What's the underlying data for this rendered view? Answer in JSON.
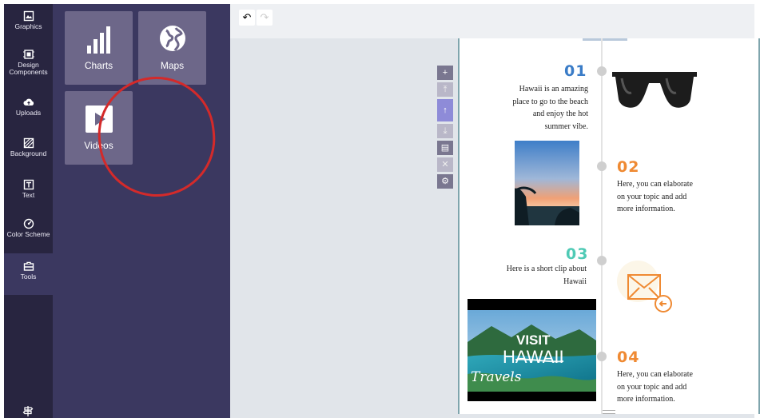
{
  "rail": {
    "items": [
      {
        "label": "Graphics",
        "icon": "image-icon"
      },
      {
        "label": "Design Components",
        "icon": "components-icon"
      },
      {
        "label": "Uploads",
        "icon": "cloud-upload-icon"
      },
      {
        "label": "Background",
        "icon": "pattern-icon"
      },
      {
        "label": "Text",
        "icon": "text-icon"
      },
      {
        "label": "Color Scheme",
        "icon": "palette-icon"
      },
      {
        "label": "Tools",
        "icon": "toolbox-icon"
      }
    ],
    "active": "Tools"
  },
  "panel": {
    "tiles": [
      {
        "label": "Charts",
        "icon": "bar-chart-icon"
      },
      {
        "label": "Maps",
        "icon": "globe-icon"
      },
      {
        "label": "Videos",
        "icon": "play-icon"
      }
    ]
  },
  "toolbar": {
    "undo": "↶",
    "redo": "↷"
  },
  "canvas_tools": [
    "+",
    "⤒",
    "↑",
    "⤓",
    "▤",
    "✕",
    "⚙"
  ],
  "infographic": {
    "steps": [
      {
        "number": "01",
        "color": "#3a7cc7",
        "text": [
          "Hawaii is an amazing",
          "place to go to the beach",
          "and enjoy the hot",
          "summer vibe."
        ]
      },
      {
        "number": "02",
        "color": "#ef8a33",
        "text": [
          "Here, you can elaborate",
          "on your topic and add",
          "more information."
        ]
      },
      {
        "number": "03",
        "color": "#4fcab5",
        "text": [
          "Here is a short clip about",
          "Hawaii"
        ]
      },
      {
        "number": "04",
        "color": "#ef8a33",
        "text": [
          "Here, you can elaborate",
          "on your topic and add",
          "more information."
        ]
      }
    ],
    "video": {
      "line1": "VISIT",
      "line2": "HAWAII",
      "line3": "Travels"
    }
  }
}
